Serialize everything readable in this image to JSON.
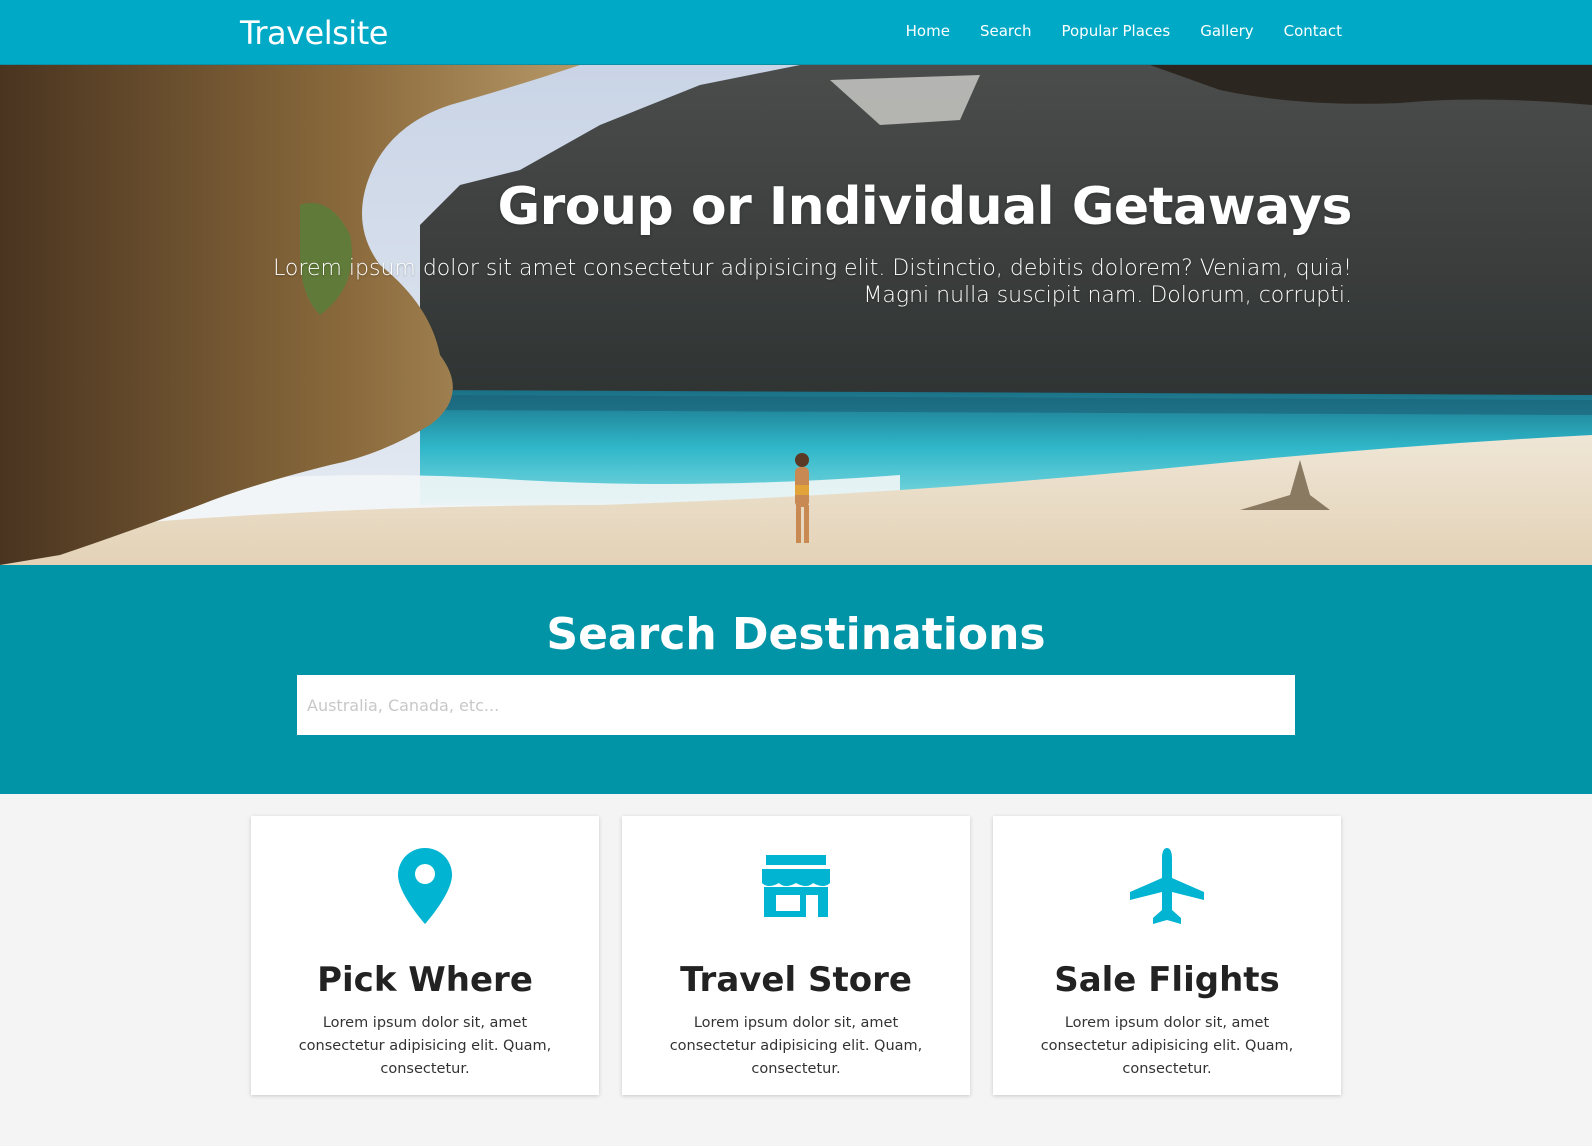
{
  "navbar": {
    "brand": "Travelsite",
    "links": [
      "Home",
      "Search",
      "Popular Places",
      "Gallery",
      "Contact"
    ]
  },
  "hero": {
    "title": "Group or Individual Getaways",
    "subtitle": "Lorem ipsum dolor sit amet consectetur adipisicing elit. Distinctio, debitis dolorem? Veniam, quia! Magni nulla suscipit nam. Dolorum, corrupti."
  },
  "search": {
    "title": "Search Destinations",
    "placeholder": "Australia, Canada, etc...",
    "value": ""
  },
  "cards": [
    {
      "icon": "map-marker-icon",
      "title": "Pick Where",
      "text": "Lorem ipsum dolor sit, amet consectetur adipisicing elit. Quam, consectetur."
    },
    {
      "icon": "store-icon",
      "title": "Travel Store",
      "text": "Lorem ipsum dolor sit, amet consectetur adipisicing elit. Quam, consectetur."
    },
    {
      "icon": "plane-icon",
      "title": "Sale Flights",
      "text": "Lorem ipsum dolor sit, amet consectetur adipisicing elit. Quam, consectetur."
    }
  ],
  "colors": {
    "navbar": "#00aac7",
    "search_section": "#0094a6",
    "icon": "#00b4d2",
    "page_bg": "#f4f4f4"
  }
}
